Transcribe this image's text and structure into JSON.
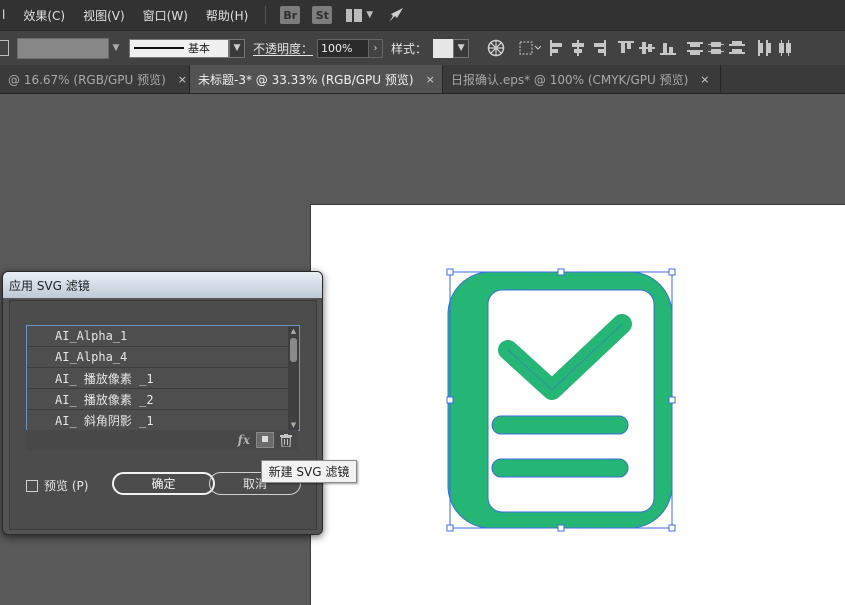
{
  "menu": {
    "items": [
      "效果(C)",
      "视图(V)",
      "窗口(W)",
      "帮助(H)"
    ],
    "badges": [
      "Br",
      "St"
    ]
  },
  "control": {
    "stroke_style_label": "基本",
    "opacity_label": "不透明度：",
    "opacity_value": "100%",
    "style_label": "样式："
  },
  "tabs": [
    {
      "label": "@ 16.67% (RGB/GPU 预览)",
      "active": false
    },
    {
      "label": "未标题-3* @ 33.33% (RGB/GPU 预览)",
      "active": true
    },
    {
      "label": "日报确认.eps* @ 100% (CMYK/GPU 预览)",
      "active": false
    }
  ],
  "tab_close": "×",
  "artwork": {
    "fill_color": "#25b574",
    "selection_color": "#3a6fe0"
  },
  "dialog": {
    "title": "应用 SVG 滤镜",
    "filters": [
      "AI_Alpha_1",
      "AI_Alpha_4",
      "AI_ 播放像素 _1",
      "AI_ 播放像素 _2",
      "AI_ 斜角阴影 _1"
    ],
    "fx_label": "fx",
    "preview_label": "预览 (P)",
    "ok_label": "确定",
    "cancel_label": "取消",
    "tooltip": "新建 SVG 滤镜"
  }
}
